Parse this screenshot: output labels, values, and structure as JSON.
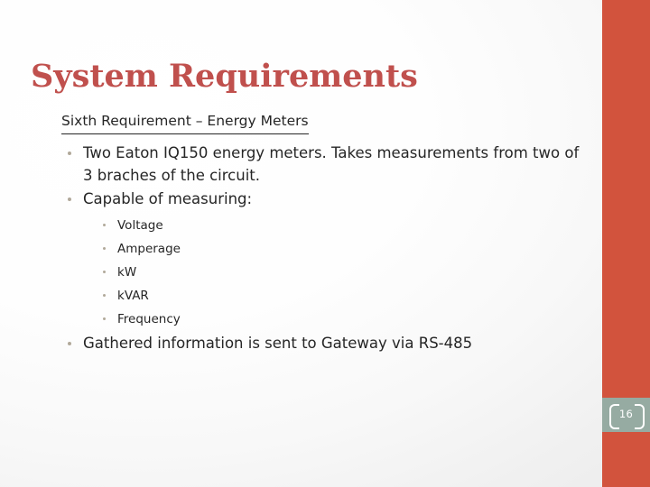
{
  "slide": {
    "title": "System Requirements",
    "page_number": "16",
    "accent_color": "#d2533d",
    "title_color": "#c0504d",
    "badge_color": "#96aba2",
    "body_color": "#262626",
    "bullet_color": "#b1a99a"
  },
  "content": {
    "section_heading": "Sixth Requirement –  Energy Meters",
    "bullets": [
      {
        "text": "Two Eaton IQ150 energy meters. Takes measurements from two of 3 braches of the circuit."
      },
      {
        "text": "Capable of measuring:",
        "sub_bullets": [
          "Voltage",
          "Amperage",
          "kW",
          "kVAR",
          "Frequency"
        ]
      },
      {
        "text": "Gathered information is sent to Gateway via RS-485"
      }
    ]
  }
}
